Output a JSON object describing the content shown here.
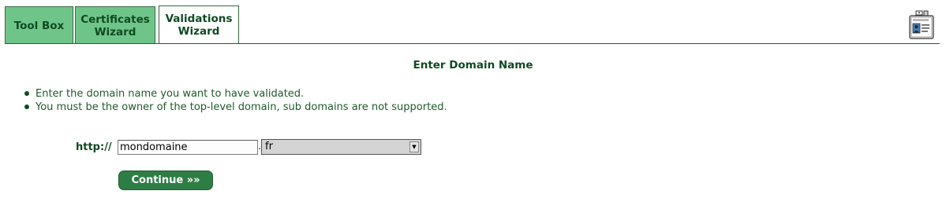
{
  "tabs": [
    {
      "label": "Tool Box",
      "active": false
    },
    {
      "label": "Certificates\nWizard",
      "active": false
    },
    {
      "label": "Validations\nWizard",
      "active": true
    }
  ],
  "header_icon": "id-badge-icon",
  "main": {
    "title": "Enter Domain Name",
    "instructions": [
      "Enter the domain name you want to have validated.",
      "You must be the owner of the top-level domain, sub domains are not supported."
    ],
    "protocol_label": "http://",
    "domain_value": "mondomaine",
    "separator": ".",
    "tld_selected": "fr",
    "continue_label": "Continue »»"
  },
  "colors": {
    "accent": "#2e7d45",
    "tab_inactive": "#6fc589",
    "text_dark_green": "#0f4a22"
  }
}
